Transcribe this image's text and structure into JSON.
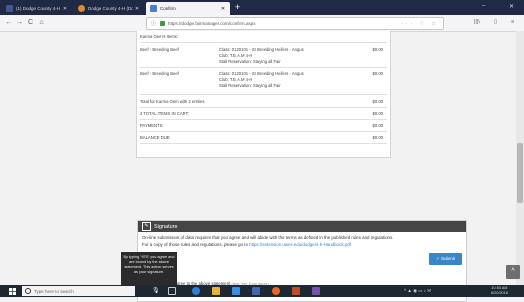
{
  "browser": {
    "tabs": [
      {
        "label": "(1) Dodge County 4-H (Wiscon",
        "icon": "facebook-icon",
        "active": false
      },
      {
        "label": "Dodge County 4-H (Dod - Sm",
        "icon": "shield-icon",
        "active": false
      },
      {
        "label": "Confirm",
        "icon": "page-icon",
        "active": true
      }
    ],
    "new_tab_label": "+",
    "url": "https://dodge.fairmanager.com/confirm.aspx",
    "url_icons": "··· ♡ ☆",
    "window_controls": {
      "minimize": "–",
      "close": "✕"
    }
  },
  "nav": {
    "back": "←",
    "forward": "→",
    "reload": "C",
    "home": "⌂",
    "library": "|||\\",
    "sidebar": "▯",
    "menu": "≡"
  },
  "entries": {
    "header": "Karma Oem's Items:",
    "items": [
      {
        "department": "Beef - Breeding Beef",
        "class": "Class: 0120101 - Sr Breeding Heifers - Angus",
        "club": "Club: T.E.A.M 4-H",
        "stall": "Stall Reservation: Staying all Fair",
        "amount": "$0.00"
      },
      {
        "department": "Beef - Breeding Beef",
        "class": "Class: 0120101 - Sr Breeding Heifers - Angus",
        "club": "Club: T.E.A.M 4-H",
        "stall": "Stall Reservation: Staying all Fair",
        "amount": "$0.00"
      }
    ],
    "total_label": "Total for Karma Oem with 2 entries",
    "total_amount": "$0.00",
    "summary": [
      {
        "label": "2 TOTAL ITEMS IN CART:",
        "amount": "$0.00"
      },
      {
        "label": "PAYMENTS:",
        "amount": "$0.00"
      },
      {
        "label": "BALANCE DUE:",
        "amount": "$0.00"
      }
    ]
  },
  "signature": {
    "title": "Signature",
    "text_1": "On-line submission of data requires that you agree and will abide with the terms as defined in the published rules and regulations.",
    "text_2": "For a copy of those rules and regulations, please go to",
    "rules_link": "https://extension.uwex.edu/dodge/4-h-Handbook.pdf",
    "submit_label": "✓ Submit",
    "agree_label": "I agree to the above statement",
    "agree_hint": "(type 'Yes' if you agree)",
    "tooltip": "By typing 'YES' you agree and are bound by the above statement. This action serves as your signature."
  },
  "scroll": {
    "up_arrow": "^"
  },
  "taskbar": {
    "search_placeholder": "Type here to search",
    "tray_icons": "^ ▲ ◉ ▭ ♪ ✉",
    "time": "10:53 AM",
    "date": "6/20/2018"
  },
  "colors": {
    "tabbar": "#202a44",
    "signature_header": "#454545",
    "submit": "#3a86c8",
    "taskbar": "#1e2833",
    "link": "#3a7fc4"
  }
}
